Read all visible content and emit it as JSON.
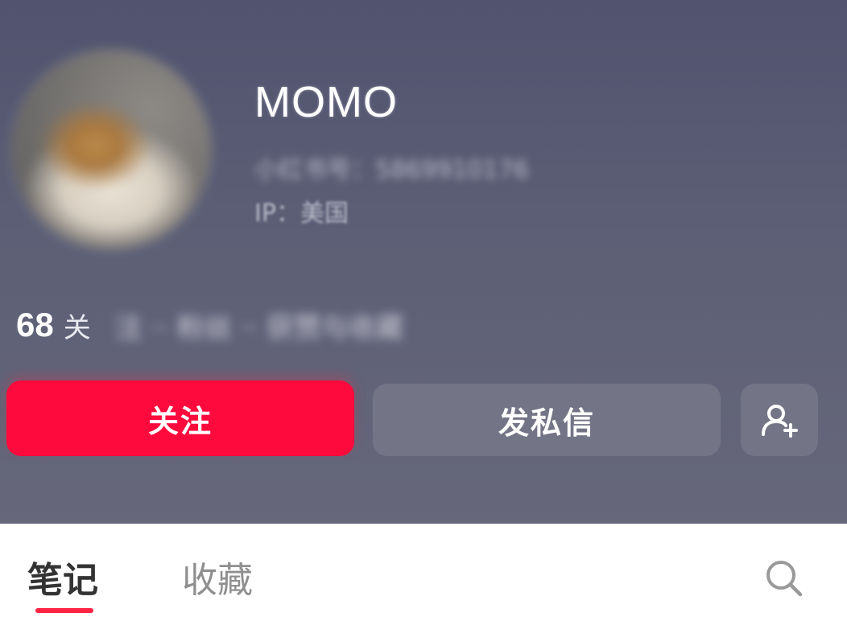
{
  "profile": {
    "username": "MOMO",
    "id_text": "小红书号：5869910176",
    "ip_text": "IP：美国"
  },
  "stats": {
    "following_count": "68",
    "following_label": "关",
    "blurred_rest": "注 ·· 粉丝 ·· 获赞与收藏"
  },
  "actions": {
    "follow_label": "关注",
    "message_label": "发私信"
  },
  "tabs": {
    "notes_label": "笔记",
    "favorites_label": "收藏"
  },
  "colors": {
    "accent": "#ff0a3c",
    "header_bg": "#5d5f76",
    "tab_active_underline": "#ff2442"
  }
}
